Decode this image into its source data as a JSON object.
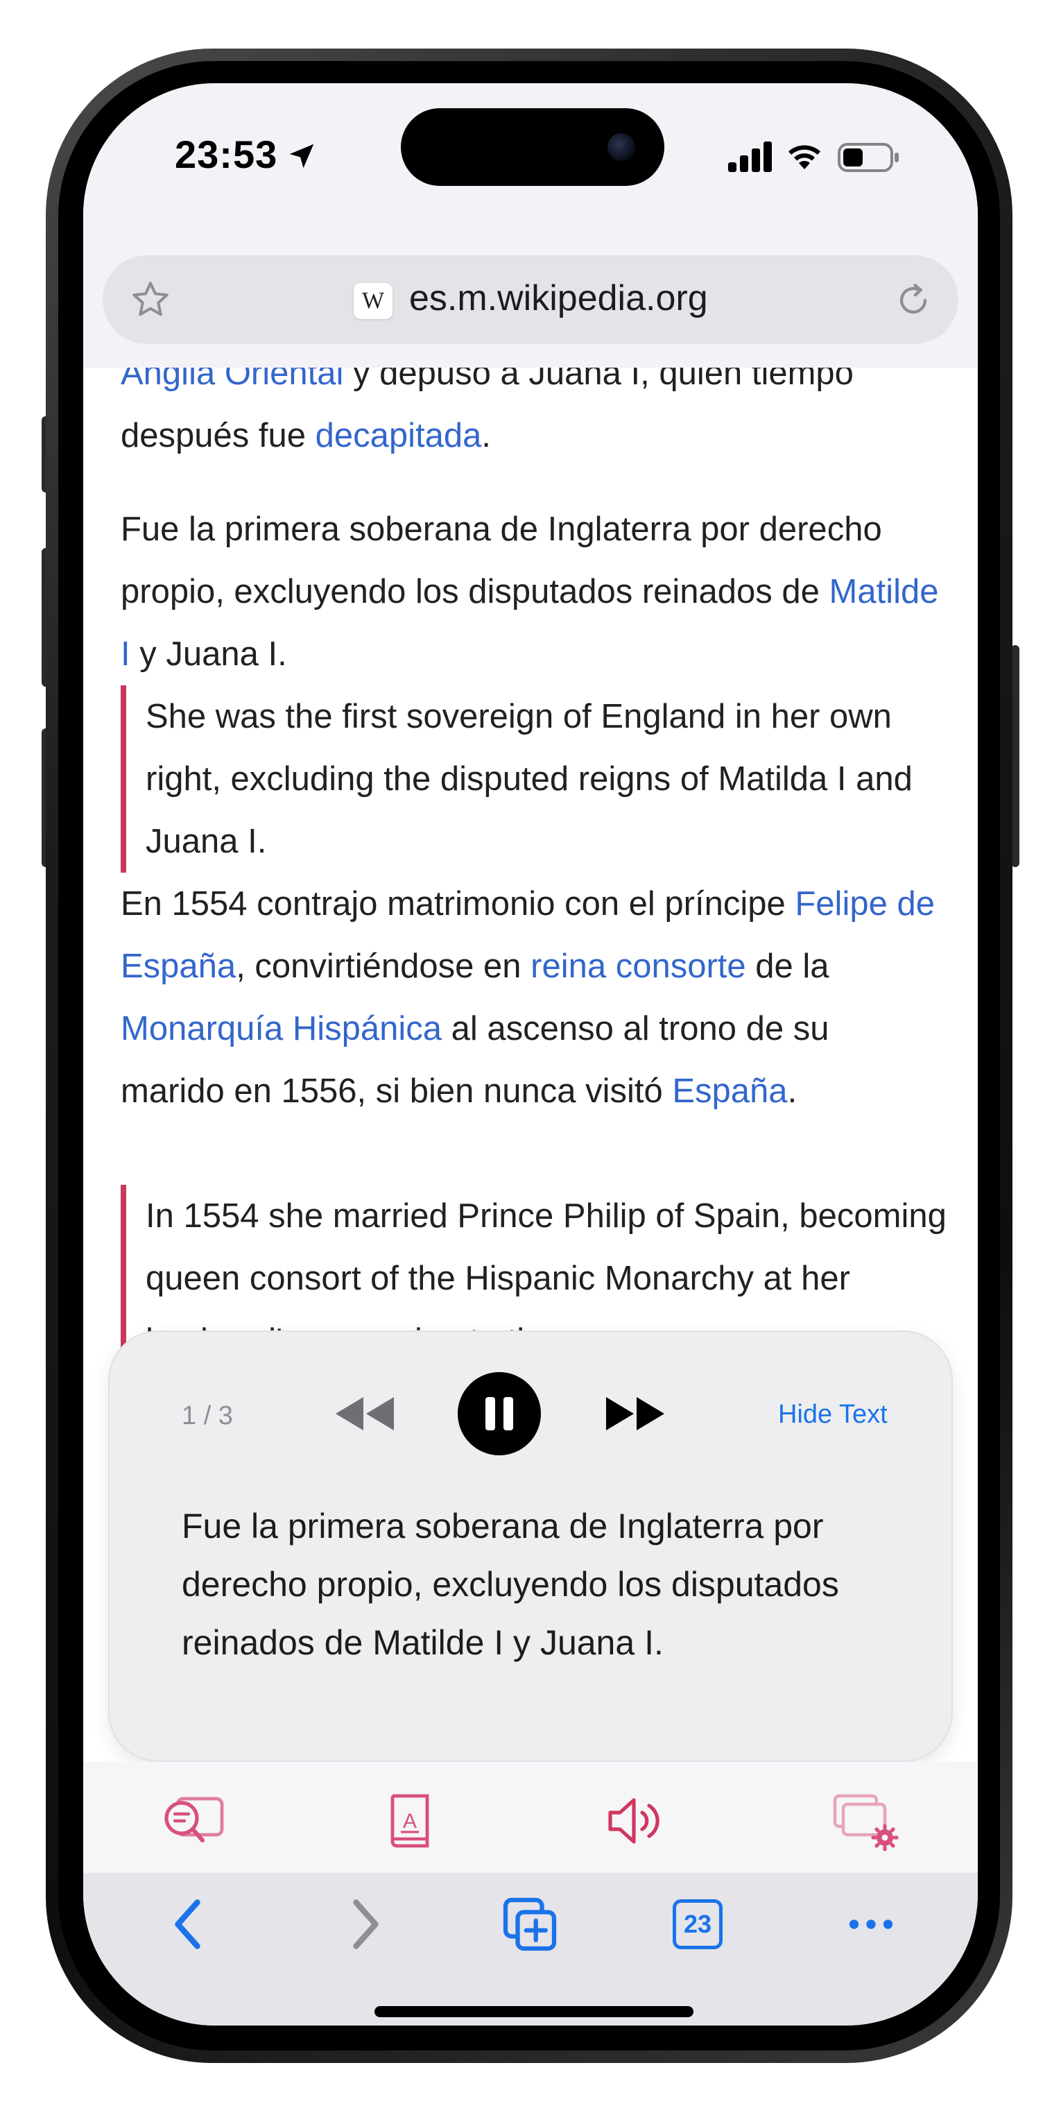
{
  "status_bar": {
    "time": "23:53",
    "icons": [
      "location-arrow-icon",
      "cellular-signal-icon",
      "wifi-icon",
      "battery-icon"
    ]
  },
  "browser": {
    "url": "es.m.wikipedia.org",
    "site_icon_letter": "W",
    "icons": [
      "bookmark-star-icon",
      "wikipedia-favicon",
      "reload-icon"
    ]
  },
  "article": {
    "partial_top_line": {
      "link1": "Anglia Oriental",
      "text": " y depuso a Juana I, quien tiempo"
    },
    "para1_rest": {
      "text_before": "después fue ",
      "link": "decapitada",
      "text_after": "."
    },
    "para2": {
      "text_before": "Fue la primera soberana de Inglaterra por derecho propio, excluyendo los disputados reinados de ",
      "link": "Matilde I",
      "text_after": " y Juana I."
    },
    "quote1": "She was the first sovereign of England in her own right, excluding the disputed reigns of Matilda I and Juana I.",
    "para3": {
      "t1": "En 1554 contrajo matrimonio con el príncipe ",
      "l1": "Felipe de España",
      "t2": ", convirtiéndose en ",
      "l2": "reina consorte",
      "t3": " de la ",
      "l3": "Monarquía Hispánica",
      "t4": " al ascenso al trono de su marido en 1556, si bien nunca visitó ",
      "l4": "España",
      "t5": "."
    },
    "quote2": "In 1554 she married Prince Philip of Spain, becoming queen consort of the Hispanic Monarchy at her husband's accession to the"
  },
  "speech_panel": {
    "pager": "1 / 3",
    "hide_text_label": "Hide Text",
    "current_sentence": "Fue la primera soberana de Inglaterra por derecho propio, excluyendo los disputados reinados de Matilde I y Juana I.",
    "state": "playing",
    "icons": [
      "rewind-icon",
      "pause-icon",
      "fast-forward-icon"
    ]
  },
  "reader_toolbar": {
    "icons": [
      "translate-lookup-icon",
      "dictionary-book-icon",
      "speaker-icon",
      "window-settings-icon"
    ],
    "accent_color": "#d94f7c"
  },
  "safari_toolbar": {
    "tabs_count": "23",
    "icons": [
      "back-chevron-icon",
      "forward-chevron-icon",
      "new-tab-icon",
      "tabs-icon",
      "more-icon"
    ],
    "accent_color": "#1a73e8"
  }
}
